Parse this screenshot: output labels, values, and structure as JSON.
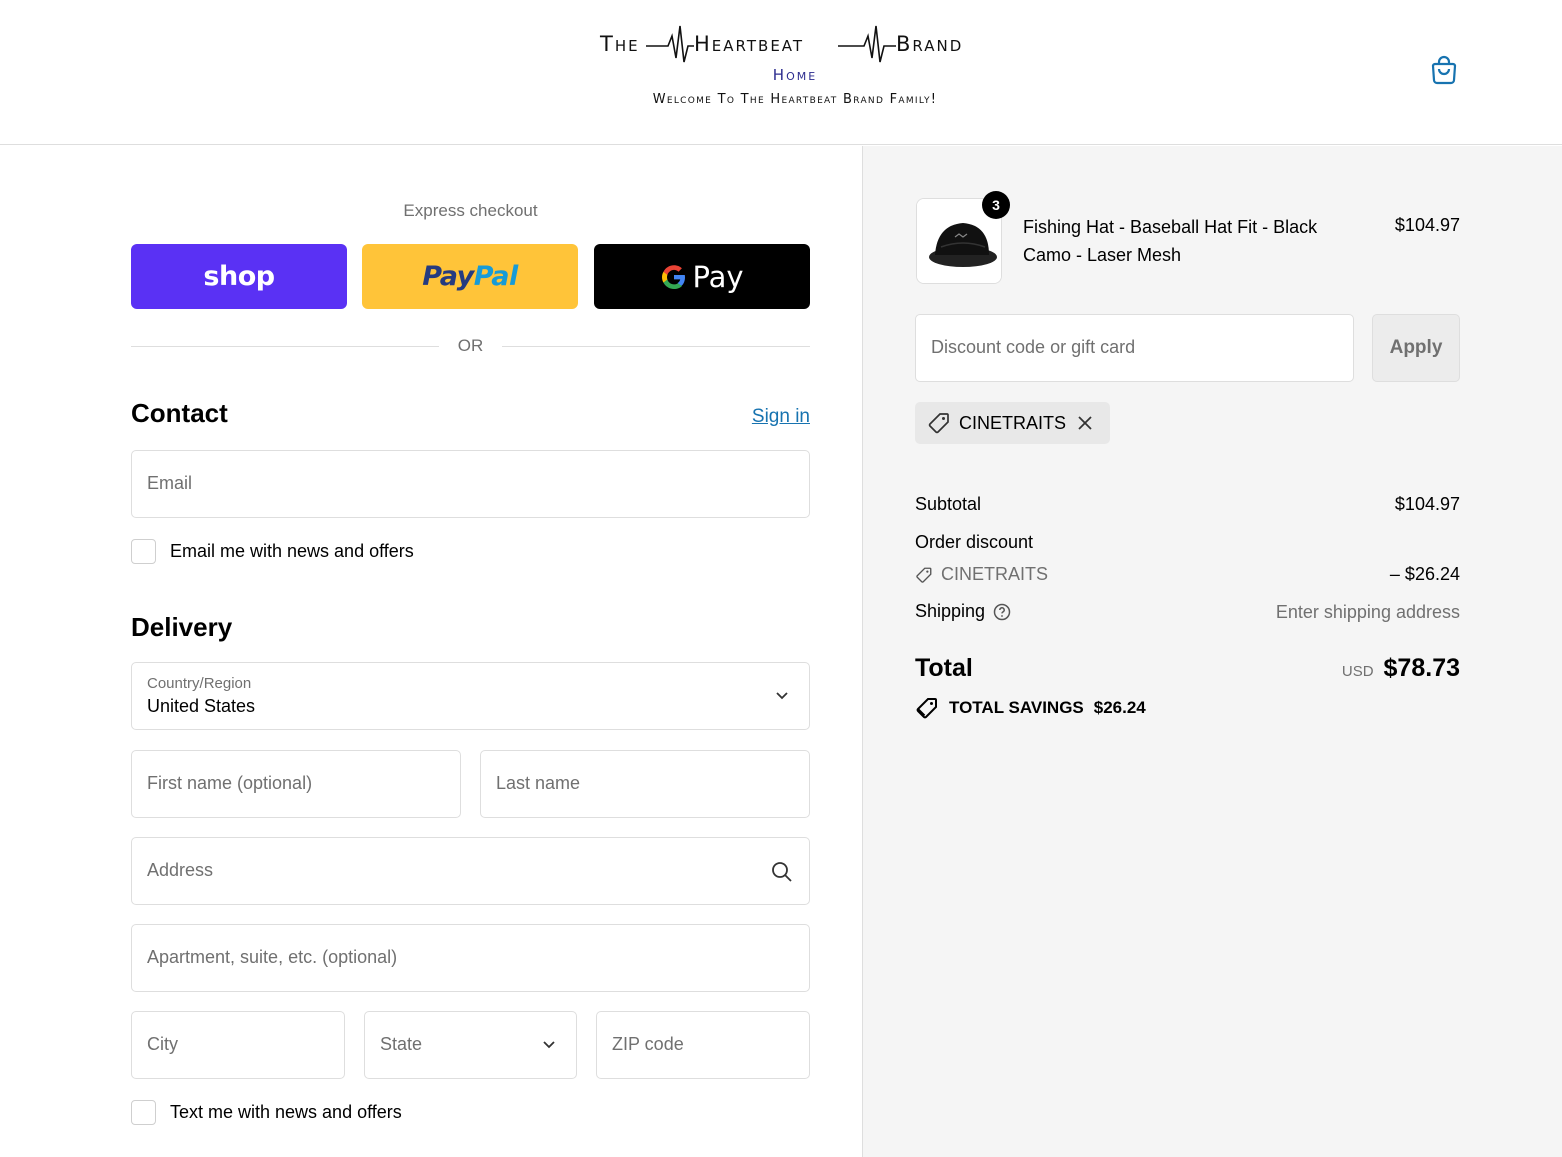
{
  "header": {
    "brand_the": "The",
    "brand_heartbeat": "Heartbeat",
    "brand_brand": "Brand",
    "home_link": "Home",
    "tagline": "Welcome To The Heartbeat Brand Family!",
    "cart_icon": "shopping-bag-icon"
  },
  "express": {
    "title": "Express checkout",
    "shop_label": "shop",
    "paypal_label_1": "Pay",
    "paypal_label_2": "Pal",
    "gpay_label": "Pay",
    "or_text": "OR"
  },
  "contact": {
    "title": "Contact",
    "sign_in": "Sign in",
    "email_placeholder": "Email",
    "news_checkbox_label": "Email me with news and offers"
  },
  "delivery": {
    "title": "Delivery",
    "country_label": "Country/Region",
    "country_value": "United States",
    "first_name_placeholder": "First name (optional)",
    "last_name_placeholder": "Last name",
    "address_placeholder": "Address",
    "apartment_placeholder": "Apartment, suite, etc. (optional)",
    "city_placeholder": "City",
    "state_placeholder": "State",
    "zip_placeholder": "ZIP code",
    "text_checkbox_label": "Text me with news and offers"
  },
  "summary": {
    "product": {
      "quantity": "3",
      "name": "Fishing Hat - Baseball Hat Fit - Black Camo - Laser Mesh",
      "price": "$104.97"
    },
    "discount_placeholder": "Discount code or gift card",
    "apply_label": "Apply",
    "applied_code": "CINETRAITS",
    "subtotal_label": "Subtotal",
    "subtotal_value": "$104.97",
    "order_discount_label": "Order discount",
    "order_discount_code": "CINETRAITS",
    "order_discount_value": "– $26.24",
    "shipping_label": "Shipping",
    "shipping_value": "Enter shipping address",
    "total_label": "Total",
    "currency": "USD",
    "total_value": "$78.73",
    "savings_label": "TOTAL SAVINGS",
    "savings_value": "$26.24"
  },
  "colors": {
    "shop_purple": "#5a31f4",
    "paypal_yellow": "#ffc439",
    "link_blue": "#1773b0",
    "summary_bg": "#f5f5f5"
  }
}
